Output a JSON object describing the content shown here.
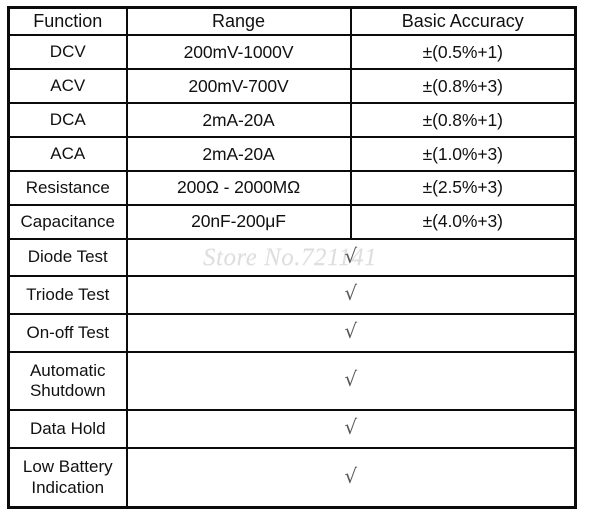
{
  "table": {
    "name": "multimeter-specification-table",
    "columns": [
      "Function",
      "Range",
      "Basic Accuracy"
    ],
    "rows": [
      {
        "function": "DCV",
        "range": "200mV-1000V",
        "accuracy": "±(0.5%+1)",
        "merged": false,
        "check": ""
      },
      {
        "function": "ACV",
        "range": "200mV-700V",
        "accuracy": "±(0.8%+3)",
        "merged": false,
        "check": ""
      },
      {
        "function": "DCA",
        "range": "2mA-20A",
        "accuracy": "±(0.8%+1)",
        "merged": false,
        "check": ""
      },
      {
        "function": "ACA",
        "range": "2mA-20A",
        "accuracy": "±(1.0%+3)",
        "merged": false,
        "check": ""
      },
      {
        "function": "Resistance",
        "range": "200Ω - 2000MΩ",
        "accuracy": "±(2.5%+3)",
        "merged": false,
        "check": ""
      },
      {
        "function": "Capacitance",
        "range": "20nF-200μF",
        "accuracy": "±(4.0%+3)",
        "merged": false,
        "check": ""
      },
      {
        "function": "Diode Test",
        "range": "",
        "accuracy": "",
        "merged": true,
        "check": "√"
      },
      {
        "function": "Triode Test",
        "range": "",
        "accuracy": "",
        "merged": true,
        "check": "√"
      },
      {
        "function": "On-off Test",
        "range": "",
        "accuracy": "",
        "merged": true,
        "check": "√"
      },
      {
        "function": "Automatic Shutdown",
        "range": "",
        "accuracy": "",
        "merged": true,
        "check": "√"
      },
      {
        "function": "Data Hold",
        "range": "",
        "accuracy": "",
        "merged": true,
        "check": "√"
      },
      {
        "function": "Low Battery Indication",
        "range": "",
        "accuracy": "",
        "merged": true,
        "check": "√"
      }
    ]
  },
  "watermark": {
    "text": "Store No.721141"
  },
  "colors": {
    "border": "#0b0b0b",
    "text": "#111111",
    "check": "#5a5a5a",
    "watermark": "#dedede",
    "background": "#ffffff"
  }
}
